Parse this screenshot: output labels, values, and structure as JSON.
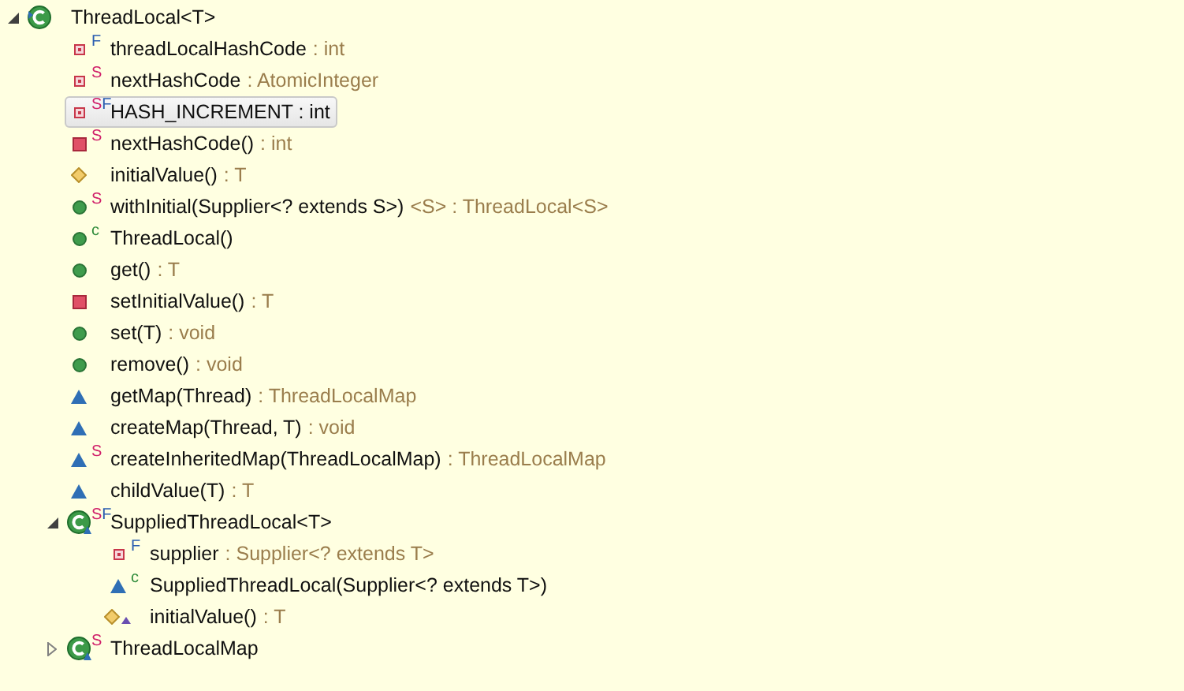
{
  "tree": [
    {
      "kind": "class",
      "name": "ThreadLocal<T>",
      "selected": false,
      "expanded": true,
      "children": [
        {
          "kind": "field_private",
          "name": "threadLocalHashCode",
          "detail": ": int",
          "badges": [
            {
              "text": "F",
              "color": "#2a5db0"
            }
          ],
          "selected": false
        },
        {
          "kind": "field_private",
          "name": "nextHashCode",
          "detail": ": AtomicInteger",
          "badges": [
            {
              "text": "S",
              "color": "#d0206a"
            }
          ],
          "selected": false
        },
        {
          "kind": "field_private",
          "name": "HASH_INCREMENT : int",
          "badges": [
            {
              "text": "S",
              "color": "#d0206a"
            },
            {
              "text": "F",
              "color": "#2a5db0"
            }
          ],
          "selected": true
        },
        {
          "kind": "method_private",
          "name": "nextHashCode()",
          "detail": ": int",
          "badges": [
            {
              "text": "S",
              "color": "#d0206a"
            }
          ],
          "selected": false
        },
        {
          "kind": "method_protected",
          "name": "initialValue()",
          "detail": ": T",
          "selected": false
        },
        {
          "kind": "method_public",
          "name": "withInitial(Supplier<? extends S>)",
          "detail": "<S> : ThreadLocal<S>",
          "badges": [
            {
              "text": "S",
              "color": "#d0206a"
            }
          ],
          "selected": false
        },
        {
          "kind": "method_public",
          "name": "ThreadLocal()",
          "badges": [
            {
              "text": "c",
              "color": "#2e8b3a"
            }
          ],
          "selected": false
        },
        {
          "kind": "method_public",
          "name": "get()",
          "detail": ": T",
          "selected": false
        },
        {
          "kind": "method_private",
          "name": "setInitialValue()",
          "detail": ": T",
          "selected": false
        },
        {
          "kind": "method_public",
          "name": "set(T)",
          "detail": ": void",
          "selected": false
        },
        {
          "kind": "method_public",
          "name": "remove()",
          "detail": ": void",
          "selected": false
        },
        {
          "kind": "method_default",
          "name": "getMap(Thread)",
          "detail": ": ThreadLocalMap",
          "selected": false
        },
        {
          "kind": "method_default",
          "name": "createMap(Thread, T)",
          "detail": ": void",
          "selected": false
        },
        {
          "kind": "method_default",
          "name": "createInheritedMap(ThreadLocalMap)",
          "detail": ": ThreadLocalMap",
          "badges": [
            {
              "text": "S",
              "color": "#d0206a"
            }
          ],
          "selected": false
        },
        {
          "kind": "method_default",
          "name": "childValue(T)",
          "detail": ": T",
          "selected": false
        },
        {
          "kind": "class_default",
          "name": "SuppliedThreadLocal<T>",
          "badges": [
            {
              "text": "S",
              "color": "#d0206a"
            },
            {
              "text": "F",
              "color": "#2a5db0"
            }
          ],
          "selected": false,
          "expanded": true,
          "children": [
            {
              "kind": "field_private",
              "name": "supplier",
              "detail": ": Supplier<? extends T>",
              "badges": [
                {
                  "text": "F",
                  "color": "#2a5db0"
                }
              ],
              "selected": false
            },
            {
              "kind": "method_default",
              "name": "SuppliedThreadLocal(Supplier<? extends T>)",
              "badges": [
                {
                  "text": "c",
                  "color": "#2e8b3a"
                }
              ],
              "selected": false
            },
            {
              "kind": "method_protected_override",
              "name": "initialValue()",
              "detail": ": T",
              "selected": false
            }
          ]
        },
        {
          "kind": "class_default",
          "name": "ThreadLocalMap",
          "badges": [
            {
              "text": "S",
              "color": "#d0206a"
            }
          ],
          "selected": false,
          "expanded": false
        }
      ]
    }
  ]
}
